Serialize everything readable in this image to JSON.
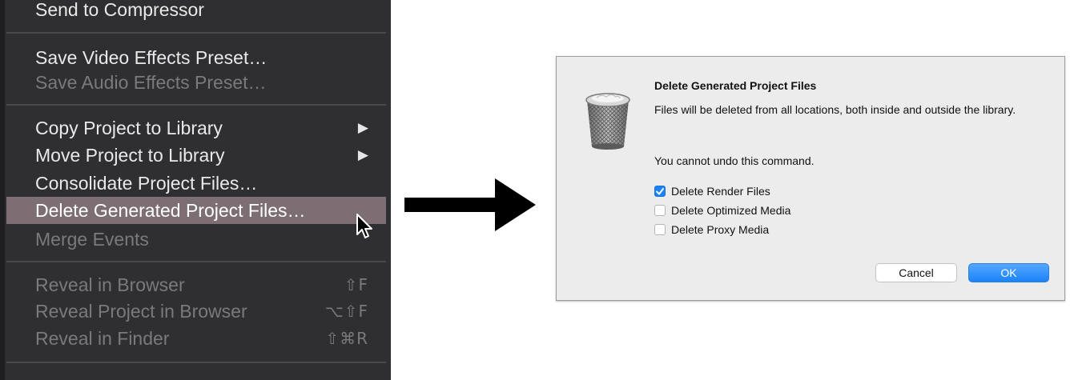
{
  "menu": {
    "items": [
      {
        "label": "Send to Compressor",
        "enabled": true
      },
      {
        "label": "Save Video Effects Preset…",
        "enabled": true
      },
      {
        "label": "Save Audio Effects Preset…",
        "enabled": false
      },
      {
        "label": "Copy Project to Library",
        "enabled": true,
        "submenu_glyph": "▶"
      },
      {
        "label": "Move Project to Library",
        "enabled": true,
        "submenu_glyph": "▶"
      },
      {
        "label": "Consolidate Project Files…",
        "enabled": true
      },
      {
        "label": "Delete Generated Project Files…",
        "enabled": true,
        "highlighted": true
      },
      {
        "label": "Merge Events",
        "enabled": false
      },
      {
        "label": "Reveal in Browser",
        "enabled": false,
        "shortcut": "⇧F"
      },
      {
        "label": "Reveal Project in Browser",
        "enabled": false,
        "shortcut": "⌥⇧F"
      },
      {
        "label": "Reveal in Finder",
        "enabled": false,
        "shortcut": "⇧⌘R"
      }
    ]
  },
  "dialog": {
    "title": "Delete Generated Project Files",
    "message": "Files will be deleted from all locations, both inside and outside the library.",
    "warning": "You cannot undo this command.",
    "options": [
      {
        "label": "Delete Render Files",
        "checked": true
      },
      {
        "label": "Delete Optimized Media",
        "checked": false
      },
      {
        "label": "Delete Proxy Media",
        "checked": false
      }
    ],
    "cancel_label": "Cancel",
    "ok_label": "OK",
    "icon": "trash-icon"
  },
  "colors": {
    "menu_bg": "#2f2f31",
    "menu_highlight": "#7c6e72",
    "accent_blue": "#1a82fb",
    "dialog_bg": "#ececec"
  }
}
